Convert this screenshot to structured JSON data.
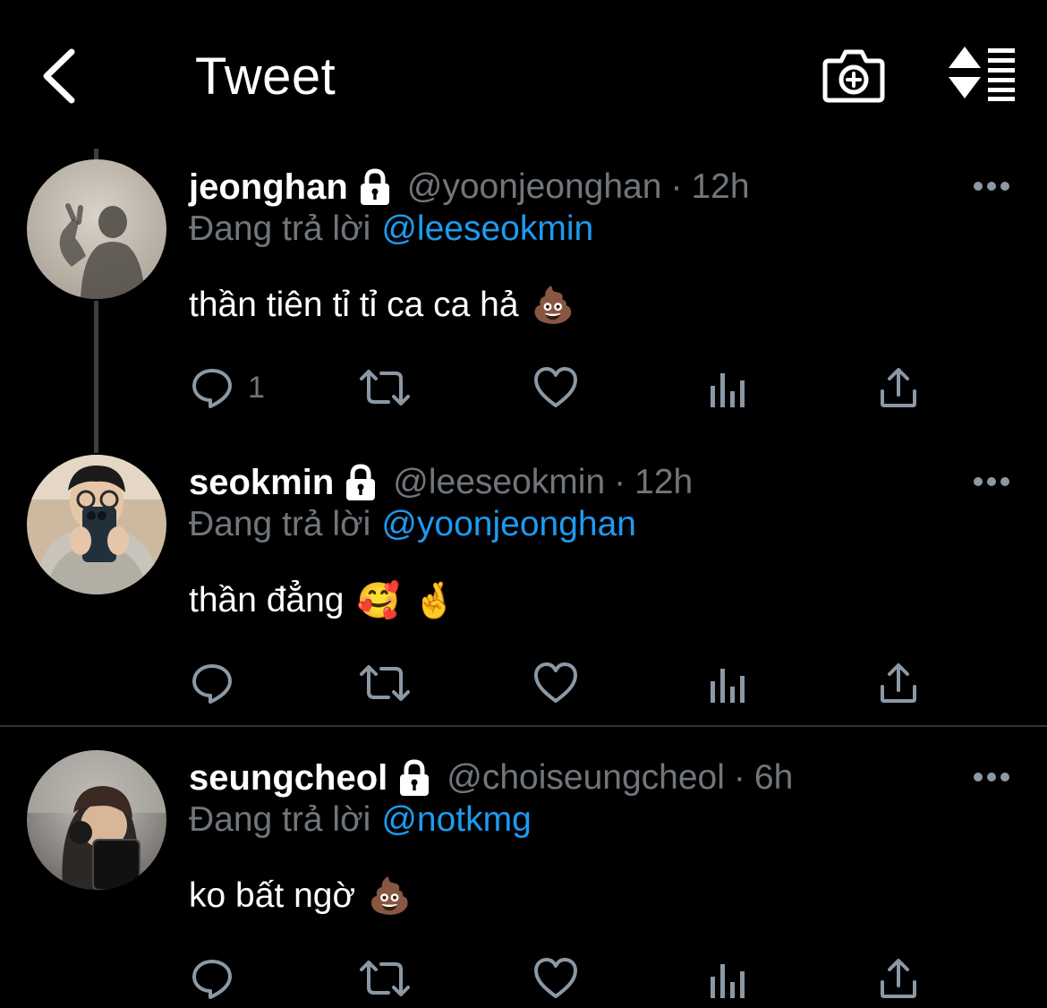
{
  "header": {
    "title": "Tweet",
    "back_icon": "chevron-left-icon",
    "camera_icon": "camera-plus-icon",
    "sort_icon": "sort-icon"
  },
  "colors": {
    "background": "#000000",
    "text": "#ffffff",
    "muted": "#71767b",
    "link": "#1d9bf0",
    "thread_line": "#3a3f45",
    "separator": "#2f3336"
  },
  "tweets": [
    {
      "display_name": "jeonghan",
      "handle": "@yoonjeonghan",
      "dot": "·",
      "time": "12h",
      "reply_prefix": "Đang trả lời",
      "reply_to": "@leeseokmin",
      "text": "thần tiên tỉ tỉ ca ca hả",
      "emojis": [
        "💩"
      ],
      "reply_count": "1"
    },
    {
      "display_name": "seokmin",
      "handle": "@leeseokmin",
      "dot": "·",
      "time": "12h",
      "reply_prefix": "Đang trả lời",
      "reply_to": "@yoonjeonghan",
      "text": "thần đẳng",
      "emojis": [
        "🥰",
        "🤞"
      ],
      "reply_count": ""
    },
    {
      "display_name": "seungcheol",
      "handle": "@choiseungcheol",
      "dot": "·",
      "time": "6h",
      "reply_prefix": "Đang trả lời",
      "reply_to": "@notkmg",
      "text": "ko bất ngờ",
      "emojis": [
        "💩"
      ],
      "reply_count": ""
    }
  ]
}
